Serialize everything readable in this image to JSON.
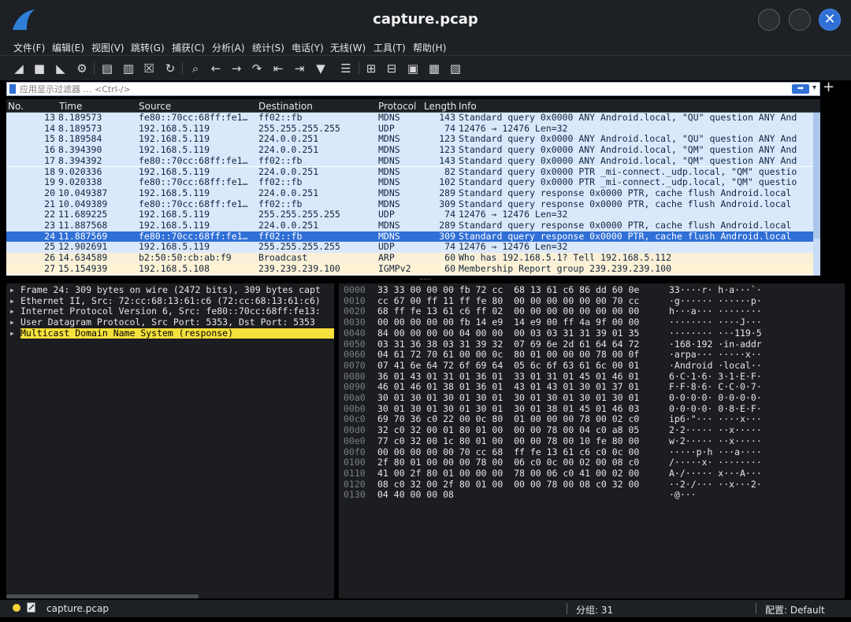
{
  "window": {
    "title": "capture.pcap",
    "close_glyph": "✕"
  },
  "menu": [
    "文件(F)",
    "编辑(E)",
    "视图(V)",
    "跳转(G)",
    "捕获(C)",
    "分析(A)",
    "统计(S)",
    "电话(Y)",
    "无线(W)",
    "工具(T)",
    "帮助(H)"
  ],
  "toolbar": {
    "buttons": [
      {
        "name": "start-capture-icon",
        "glyph": "◢"
      },
      {
        "name": "stop-capture-icon",
        "glyph": "■"
      },
      {
        "name": "restart-capture-icon",
        "glyph": "◣"
      },
      {
        "name": "capture-options-icon",
        "glyph": "⚙"
      },
      {
        "name": "open-file-icon",
        "glyph": "▤"
      },
      {
        "name": "save-file-icon",
        "glyph": "▥"
      },
      {
        "name": "close-file-icon",
        "glyph": "☒"
      },
      {
        "name": "reload-file-icon",
        "glyph": "↻"
      },
      {
        "name": "find-packet-icon",
        "glyph": "⌕"
      },
      {
        "name": "go-back-icon",
        "glyph": "←"
      },
      {
        "name": "go-forward-icon",
        "glyph": "→"
      },
      {
        "name": "go-to-packet-icon",
        "glyph": "↷"
      },
      {
        "name": "go-first-packet-icon",
        "glyph": "⇤"
      },
      {
        "name": "go-last-packet-icon",
        "glyph": "⇥"
      },
      {
        "name": "auto-scroll-icon",
        "glyph": "▼"
      },
      {
        "name": "colorize-icon",
        "glyph": "☰"
      },
      {
        "name": "zoom-in-icon",
        "glyph": "⊞"
      },
      {
        "name": "zoom-out-icon",
        "glyph": "⊟"
      },
      {
        "name": "zoom-normal-icon",
        "glyph": "▣"
      },
      {
        "name": "resize-columns-icon",
        "glyph": "▦"
      }
    ]
  },
  "filter": {
    "placeholder": "应用显示过滤器 … <Ctrl-/>",
    "apply_glyph": "➡",
    "dropdown_glyph": "▾",
    "add_glyph": "+"
  },
  "packet_list": {
    "columns": [
      "No.",
      "Time",
      "Source",
      "Destination",
      "Protocol",
      "Length",
      "Info"
    ],
    "rows": [
      {
        "no": "13",
        "time": "8.189573",
        "src": "fe80::70cc:68ff:fe1…",
        "dst": "ff02::fb",
        "proto": "MDNS",
        "len": "143",
        "info": "Standard query 0x0000 ANY Android.local, \"QU\" question ANY And",
        "type": "mdns"
      },
      {
        "no": "14",
        "time": "8.189573",
        "src": "192.168.5.119",
        "dst": "255.255.255.255",
        "proto": "UDP",
        "len": "74",
        "info": "12476 → 12476 Len=32",
        "type": "udp"
      },
      {
        "no": "15",
        "time": "8.189584",
        "src": "192.168.5.119",
        "dst": "224.0.0.251",
        "proto": "MDNS",
        "len": "123",
        "info": "Standard query 0x0000 ANY Android.local, \"QU\" question ANY And",
        "type": "mdns"
      },
      {
        "no": "16",
        "time": "8.394390",
        "src": "192.168.5.119",
        "dst": "224.0.0.251",
        "proto": "MDNS",
        "len": "123",
        "info": "Standard query 0x0000 ANY Android.local, \"QM\" question ANY And",
        "type": "mdns"
      },
      {
        "no": "17",
        "time": "8.394392",
        "src": "fe80::70cc:68ff:fe1…",
        "dst": "ff02::fb",
        "proto": "MDNS",
        "len": "143",
        "info": "Standard query 0x0000 ANY Android.local, \"QM\" question ANY And",
        "type": "mdns"
      },
      {
        "no": "18",
        "time": "9.020336",
        "src": "192.168.5.119",
        "dst": "224.0.0.251",
        "proto": "MDNS",
        "len": "82",
        "info": "Standard query 0x0000 PTR _mi-connect._udp.local, \"QM\" questio",
        "type": "mdns"
      },
      {
        "no": "19",
        "time": "9.020338",
        "src": "fe80::70cc:68ff:fe1…",
        "dst": "ff02::fb",
        "proto": "MDNS",
        "len": "102",
        "info": "Standard query 0x0000 PTR _mi-connect._udp.local, \"QM\" questio",
        "type": "mdns"
      },
      {
        "no": "20",
        "time": "10.049387",
        "src": "192.168.5.119",
        "dst": "224.0.0.251",
        "proto": "MDNS",
        "len": "289",
        "info": "Standard query response 0x0000 PTR, cache flush Android.local",
        "type": "mdns"
      },
      {
        "no": "21",
        "time": "10.049389",
        "src": "fe80::70cc:68ff:fe1…",
        "dst": "ff02::fb",
        "proto": "MDNS",
        "len": "309",
        "info": "Standard query response 0x0000 PTR, cache flush Android.local",
        "type": "mdns"
      },
      {
        "no": "22",
        "time": "11.689225",
        "src": "192.168.5.119",
        "dst": "255.255.255.255",
        "proto": "UDP",
        "len": "74",
        "info": "12476 → 12476 Len=32",
        "type": "udp"
      },
      {
        "no": "23",
        "time": "11.887568",
        "src": "192.168.5.119",
        "dst": "224.0.0.251",
        "proto": "MDNS",
        "len": "289",
        "info": "Standard query response 0x0000 PTR, cache flush Android.local",
        "type": "mdns"
      },
      {
        "no": "24",
        "time": "11.887569",
        "src": "fe80::70cc:68ff:fe1…",
        "dst": "ff02::fb",
        "proto": "MDNS",
        "len": "309",
        "info": "Standard query response 0x0000 PTR, cache flush Android.local",
        "type": "selected"
      },
      {
        "no": "25",
        "time": "12.902691",
        "src": "192.168.5.119",
        "dst": "255.255.255.255",
        "proto": "UDP",
        "len": "74",
        "info": "12476 → 12476 Len=32",
        "type": "udp"
      },
      {
        "no": "26",
        "time": "14.634589",
        "src": "b2:50:50:cb:ab:f9",
        "dst": "Broadcast",
        "proto": "ARP",
        "len": "60",
        "info": "Who has 192.168.5.1? Tell 192.168.5.112",
        "type": "arp"
      },
      {
        "no": "27",
        "time": "15.154939",
        "src": "192.168.5.108",
        "dst": "239.239.239.100",
        "proto": "IGMPv2",
        "len": "60",
        "info": "Membership Report group 239.239.239.100",
        "type": "igmp"
      }
    ]
  },
  "details": [
    {
      "text": "Frame 24: 309 bytes on wire (2472 bits), 309 bytes capt",
      "highlight": false
    },
    {
      "text": "Ethernet II, Src: 72:cc:68:13:61:c6 (72:cc:68:13:61:c6)",
      "highlight": false
    },
    {
      "text": "Internet Protocol Version 6, Src: fe80::70cc:68ff:fe13:",
      "highlight": false
    },
    {
      "text": "User Datagram Protocol, Src Port: 5353, Dst Port: 5353",
      "highlight": false
    },
    {
      "text": "Multicast Domain Name System (response)",
      "highlight": true
    }
  ],
  "bytes": [
    {
      "off": "0000",
      "hex": "33 33 00 00 00 fb 72 cc  68 13 61 c6 86 dd 60 0e",
      "asc": "33····r· h·a···`·"
    },
    {
      "off": "0010",
      "hex": "cc 67 00 ff 11 ff fe 80  00 00 00 00 00 00 70 cc",
      "asc": "·g······ ······p·"
    },
    {
      "off": "0020",
      "hex": "68 ff fe 13 61 c6 ff 02  00 00 00 00 00 00 00 00",
      "asc": "h···a··· ········"
    },
    {
      "off": "0030",
      "hex": "00 00 00 00 00 fb 14 e9  14 e9 00 ff 4a 9f 00 00",
      "asc": "········ ····J···"
    },
    {
      "off": "0040",
      "hex": "84 00 00 00 00 04 00 00  00 03 03 31 31 39 01 35",
      "asc": "········ ···119·5"
    },
    {
      "off": "0050",
      "hex": "03 31 36 38 03 31 39 32  07 69 6e 2d 61 64 64 72",
      "asc": "·168·192 ·in-addr"
    },
    {
      "off": "0060",
      "hex": "04 61 72 70 61 00 00 0c  80 01 00 00 00 78 00 0f",
      "asc": "·arpa··· ·····x··"
    },
    {
      "off": "0070",
      "hex": "07 41 6e 64 72 6f 69 64  05 6c 6f 63 61 6c 00 01",
      "asc": "·Android ·local··"
    },
    {
      "off": "0080",
      "hex": "36 01 43 01 31 01 36 01  33 01 31 01 45 01 46 01",
      "asc": "6·C·1·6· 3·1·E·F·"
    },
    {
      "off": "0090",
      "hex": "46 01 46 01 38 01 36 01  43 01 43 01 30 01 37 01",
      "asc": "F·F·8·6· C·C·0·7·"
    },
    {
      "off": "00a0",
      "hex": "30 01 30 01 30 01 30 01  30 01 30 01 30 01 30 01",
      "asc": "0·0·0·0· 0·0·0·0·"
    },
    {
      "off": "00b0",
      "hex": "30 01 30 01 30 01 30 01  30 01 38 01 45 01 46 03",
      "asc": "0·0·0·0· 0·8·E·F·"
    },
    {
      "off": "00c0",
      "hex": "69 70 36 c0 22 00 0c 80  01 00 00 00 78 00 02 c0",
      "asc": "ip6·\"··· ····x···"
    },
    {
      "off": "00d0",
      "hex": "32 c0 32 00 01 80 01 00  00 00 78 00 04 c0 a8 05",
      "asc": "2·2····· ··x·····"
    },
    {
      "off": "00e0",
      "hex": "77 c0 32 00 1c 80 01 00  00 00 78 00 10 fe 80 00",
      "asc": "w·2····· ··x·····"
    },
    {
      "off": "00f0",
      "hex": "00 00 00 00 00 70 cc 68  ff fe 13 61 c6 c0 0c 00",
      "asc": "·····p·h ···a····"
    },
    {
      "off": "0100",
      "hex": "2f 80 01 00 00 00 78 00  06 c0 0c 00 02 00 08 c0",
      "asc": "/·····x· ········"
    },
    {
      "off": "0110",
      "hex": "41 00 2f 80 01 00 00 00  78 00 06 c0 41 00 02 00",
      "asc": "A·/····· x···A···"
    },
    {
      "off": "0120",
      "hex": "08 c0 32 00 2f 80 01 00  00 00 78 00 08 c0 32 00",
      "asc": "··2·/··· ··x···2·"
    },
    {
      "off": "0130",
      "hex": "04 40 00 00 08",
      "asc": "·@···"
    }
  ],
  "status": {
    "file": "capture.pcap",
    "packets": "分组: 31",
    "profile": "配置: Default"
  },
  "colors": {
    "accent": "#2f6fd6",
    "mdns_row": "#dae8fc",
    "arp_row": "#faf0d7",
    "highlight": "#f5e13c"
  }
}
